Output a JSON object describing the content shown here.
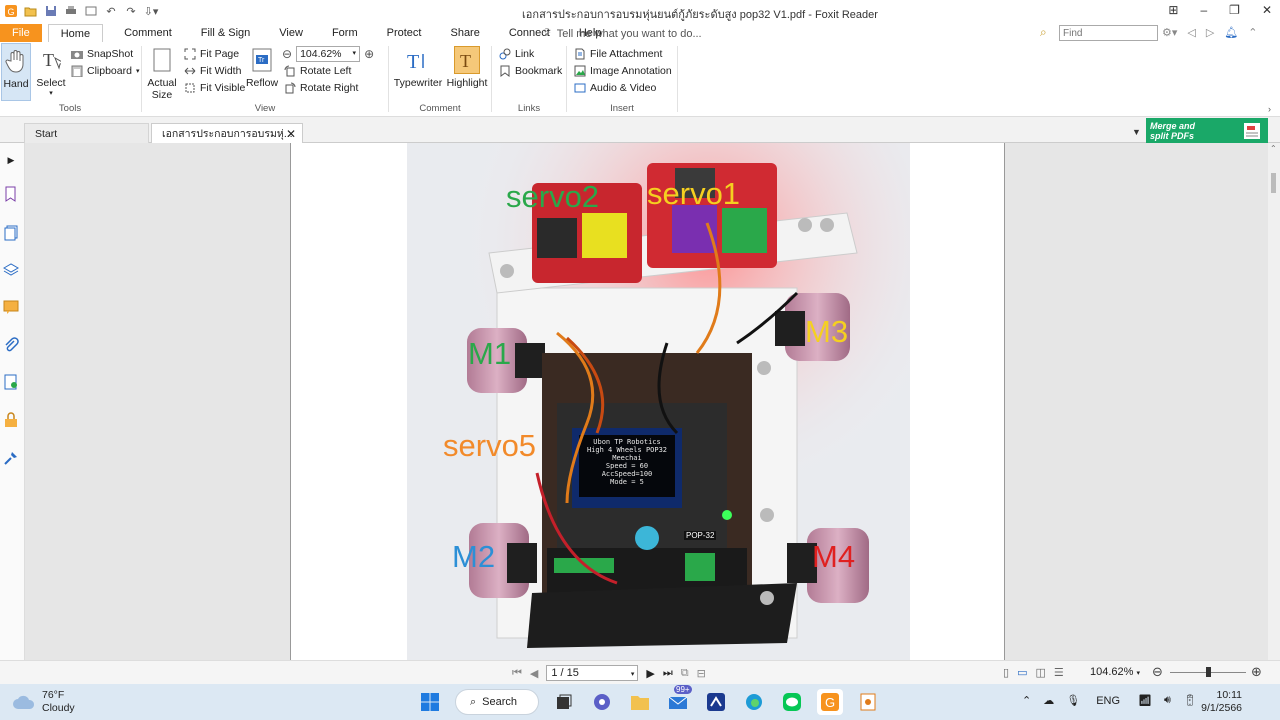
{
  "window": {
    "title": "เอกสารประกอบการอบรมหุ่นยนต์กู้ภัยระดับสูง pop32 V1.pdf - Foxit Reader"
  },
  "menu": {
    "tabs": [
      "File",
      "Home",
      "Comment",
      "Fill & Sign",
      "View",
      "Form",
      "Protect",
      "Share",
      "Connect",
      "Help"
    ],
    "tell_me": "Tell me what you want to do...",
    "find_placeholder": "Find"
  },
  "ribbon": {
    "tools": {
      "label": "Tools",
      "hand": "Hand",
      "select": "Select",
      "snapshot": "SnapShot",
      "clipboard": "Clipboard"
    },
    "view": {
      "label": "View",
      "actual_size_1": "Actual",
      "actual_size_2": "Size",
      "fit_page": "Fit Page",
      "fit_width": "Fit Width",
      "fit_visible": "Fit Visible",
      "reflow": "Reflow",
      "zoom_value": "104.62%",
      "rotate_left": "Rotate Left",
      "rotate_right": "Rotate Right"
    },
    "comment": {
      "label": "Comment",
      "typewriter": "Typewriter",
      "highlight": "Highlight"
    },
    "links": {
      "label": "Links",
      "link": "Link",
      "bookmark": "Bookmark"
    },
    "insert": {
      "label": "Insert",
      "file_attachment": "File Attachment",
      "image_annotation": "Image Annotation",
      "audio_video": "Audio & Video"
    }
  },
  "doc_tabs": {
    "start": "Start",
    "doc": "เอกสารประกอบการอบรมหุ่...",
    "promo_1": "Merge and",
    "promo_2": "split PDFs"
  },
  "photo_labels": {
    "servo1": "servo1",
    "servo2": "servo2",
    "servo5": "servo5",
    "m1": "M1",
    "m2": "M2",
    "m3": "M3",
    "m4": "M4",
    "oled": [
      "Ubon TP Robotics",
      "High 4 Wheels POP32",
      "Meechai",
      "Speed = 60",
      "AccSpeed=100",
      "Mode = 5"
    ],
    "board_pop": "POP-32"
  },
  "status": {
    "page": "1 / 15",
    "zoom": "104.62%"
  },
  "taskbar": {
    "temp": "76°F",
    "condition": "Cloudy",
    "search": "Search",
    "badge": "99+",
    "lang": "ENG",
    "time": "10:11",
    "date": "9/1/2566"
  },
  "colors": {
    "file_tab": "#f7931e",
    "promo": "#1aa868",
    "servo1": "#f5d020",
    "servo2": "#2aa84a",
    "servo5": "#f28a2a",
    "m1": "#2aa84a",
    "m2": "#2c8fd6",
    "m3": "#f5d020",
    "m4": "#e02020"
  }
}
